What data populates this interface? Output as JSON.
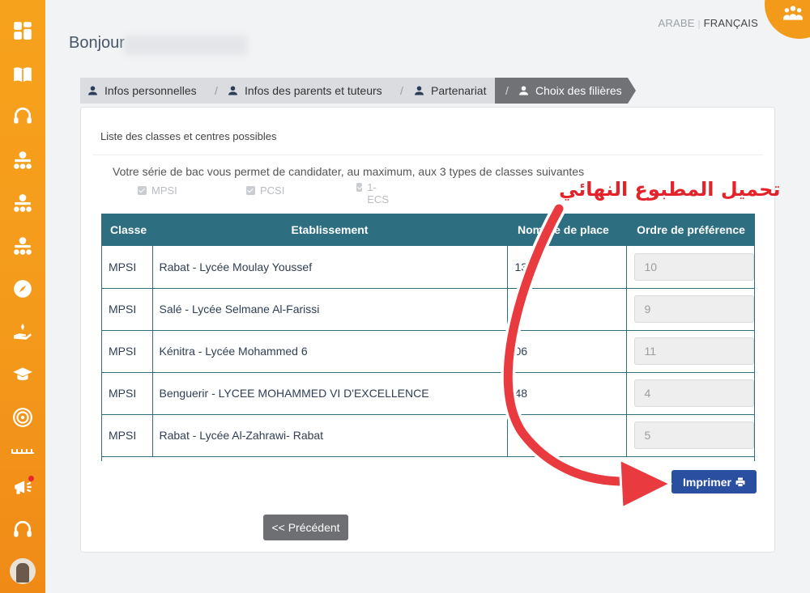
{
  "header": {
    "greeting": "Bonjour",
    "lang_arabic": "ARABE",
    "lang_separator": "|",
    "lang_french": "FRANÇAIS"
  },
  "sidebar": {
    "icons": [
      "dashboard-icon",
      "book-icon",
      "headset-icon",
      "org-network-icon",
      "org-network-icon",
      "org-network-icon",
      "compass-icon",
      "hand-growth-icon",
      "graduation-cap-icon",
      "target-icon",
      "megaphone-icon",
      "headset-icon"
    ],
    "notification_color": "#e8262c"
  },
  "steps": [
    {
      "label": "Infos personnelles",
      "active": false
    },
    {
      "label": "Infos des parents et tuteurs",
      "active": false
    },
    {
      "label": "Partenariat",
      "active": false
    },
    {
      "label": "Choix des filières",
      "active": true
    }
  ],
  "steps_separator": "/",
  "panel": {
    "title": "Liste des classes et centres possibles",
    "intro": "Votre série de bac vous permet de candidater, au maximum, aux 3 types de classes suivantes",
    "class_types": [
      {
        "label": "MPSI",
        "checked": true
      },
      {
        "label": "PCSI",
        "checked": true
      },
      {
        "label": "1-\nECS",
        "checked": true
      }
    ]
  },
  "table": {
    "headers": [
      "Classe",
      "Etablissement",
      "Nombre de place",
      "Ordre de préférence"
    ],
    "rows": [
      {
        "classe": "MPSI",
        "etablissement": "Rabat - Lycée Moulay Youssef",
        "places": "137",
        "ordre": "10"
      },
      {
        "classe": "MPSI",
        "etablissement": "Salé - Lycée Selmane Al-Farissi",
        "places": "1",
        "ordre": "9"
      },
      {
        "classe": "MPSI",
        "etablissement": "Kénitra - Lycée Mohammed 6",
        "places": "06",
        "ordre": "11"
      },
      {
        "classe": "MPSI",
        "etablissement": "Benguerir - LYCEE MOHAMMED VI D'EXCELLENCE",
        "places": "48",
        "ordre": "4"
      },
      {
        "classe": "MPSI",
        "etablissement": "Rabat - Lycée Al-Zahrawi- Rabat",
        "places": "",
        "ordre": "5"
      }
    ]
  },
  "buttons": {
    "print": "Imprimer",
    "previous": "<< Précédent"
  },
  "annotation": {
    "text": "تحميل المطبوع النهائي",
    "color": "#e3222a"
  },
  "colors": {
    "sidebar": "#f49a1b",
    "table_header": "#2d6f80",
    "print_button": "#2a4fa0",
    "active_step": "#707276"
  }
}
